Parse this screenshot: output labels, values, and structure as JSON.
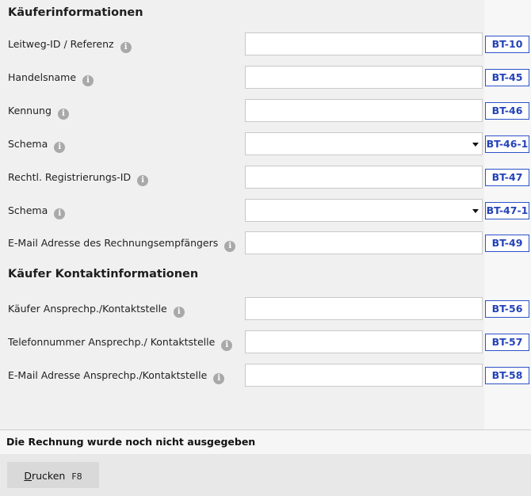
{
  "sections": {
    "buyer_title": "Käuferinformationen",
    "contact_title": "Käufer Kontaktinformationen"
  },
  "buyer_fields": [
    {
      "label": "Leitweg-ID / Referenz",
      "code": "BT-10",
      "type": "text",
      "value": ""
    },
    {
      "label": "Handelsname",
      "code": "BT-45",
      "type": "text",
      "value": ""
    },
    {
      "label": "Kennung",
      "code": "BT-46",
      "type": "text",
      "value": ""
    },
    {
      "label": "Schema",
      "code": "BT-46-1",
      "type": "select",
      "value": ""
    },
    {
      "label": "Rechtl. Registrierungs-ID",
      "code": "BT-47",
      "type": "text",
      "value": ""
    },
    {
      "label": "Schema",
      "code": "BT-47-1",
      "type": "select",
      "value": ""
    },
    {
      "label": "E-Mail Adresse des Rechnungsempfängers",
      "code": "BT-49",
      "type": "text",
      "value": ""
    }
  ],
  "contact_fields": [
    {
      "label": "Käufer Ansprechp./Kontaktstelle",
      "code": "BT-56",
      "type": "text",
      "value": ""
    },
    {
      "label": "Telefonnummer Ansprechp./ Kontaktstelle",
      "code": "BT-57",
      "type": "text",
      "value": ""
    },
    {
      "label": "E-Mail Adresse Ansprechp./Kontaktstelle",
      "code": "BT-58",
      "type": "text",
      "value": ""
    }
  ],
  "info_icon_glyph": "i",
  "status": {
    "text": "Die Rechnung wurde noch nicht ausgegeben"
  },
  "print_button": {
    "mnemonic": "D",
    "rest": "rucken",
    "shortcut": "F8"
  },
  "colors": {
    "bt_border": "#2c52c9",
    "bt_text": "#2443b8"
  }
}
